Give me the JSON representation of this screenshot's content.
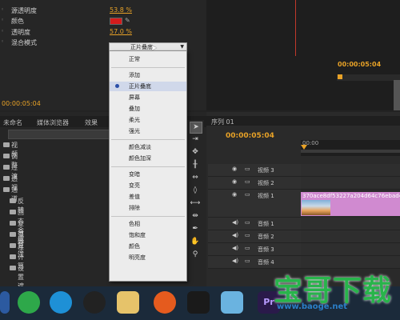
{
  "effect_controls": {
    "rows": [
      {
        "name": "源透明度",
        "value": "53.8 %"
      },
      {
        "name": "颜色"
      },
      {
        "name": "透明度",
        "value": "57.0 %"
      },
      {
        "name": "混合模式"
      }
    ],
    "blend_mode_selected": "正片叠底",
    "timecode": "00:00:05:04"
  },
  "blend_menu": {
    "items": [
      "正常",
      "添加",
      "正片叠底",
      "屏幕",
      "叠加",
      "柔光",
      "强光",
      "颜色减淡",
      "颜色加深",
      "变暗",
      "变亮",
      "差值",
      "排除",
      "色相",
      "饱和度",
      "颜色",
      "明亮度"
    ],
    "selected": "正片叠底"
  },
  "project_panel": {
    "tabs": [
      "未命名",
      "媒体浏览器",
      "效果"
    ],
    "tree": [
      "视频",
      "调整",
      "过渡",
      "透视",
      "通道",
      "反转",
      "固态合成",
      "复合算法",
      "混合",
      "算法",
      "计算",
      "设置遮罩"
    ]
  },
  "monitor": {
    "timecode": "00:00:05:04"
  },
  "timeline": {
    "tab": "序列 01",
    "timecode": "00:00:05:04",
    "ruler_label": "00:00",
    "tracks": [
      {
        "name": "视频 3"
      },
      {
        "name": "视频 2"
      },
      {
        "name": "视频 1"
      },
      {
        "name": "音频 1"
      },
      {
        "name": "音频 2"
      },
      {
        "name": "音频 3"
      },
      {
        "name": "音频 4"
      }
    ],
    "clip_title": "370ace8df53227a204d64c76ebad4"
  },
  "taskbar": {
    "premiere_label": "Pr"
  },
  "watermark": {
    "title": "宝哥下载",
    "url": "www.baoge.net"
  },
  "colors": {
    "accent": "#e8a227",
    "swatch": "#d41c1c",
    "clip": "#d08ad0",
    "watermark": "#28b44b"
  }
}
